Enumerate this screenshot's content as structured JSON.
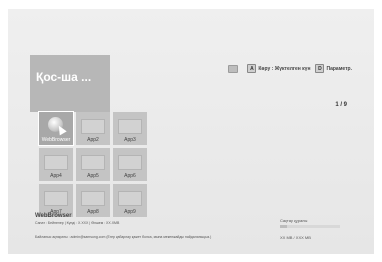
{
  "header": {
    "title": "Қос-ша ...",
    "page_indicator": "1 / 9"
  },
  "hints": [
    {
      "key": "A",
      "label": "Көру : Жүктелген күн"
    },
    {
      "key": "D",
      "label": "Параметр."
    }
  ],
  "apps": [
    {
      "label": "WebBrowser",
      "selected": true
    },
    {
      "label": "App2"
    },
    {
      "label": "App3"
    },
    {
      "label": "App4"
    },
    {
      "label": "App5"
    },
    {
      "label": "App6"
    },
    {
      "label": "App7"
    },
    {
      "label": "App8"
    },
    {
      "label": "App9"
    }
  ],
  "details": {
    "name": "WebBrowser",
    "meta": "Санат : Бейнелер  |  Күнді : X.XXX  |  Өлшем : XX.XMB",
    "contact": "Байланыс ақпараты : admin@samsung.com (Егер қабарлау қажет болса, мына мекенжайды пайдаланыңыз.)"
  },
  "storage": {
    "label": "Сақтау құралы",
    "value": "XX MB / XXX MB",
    "fraction": 0.12
  }
}
